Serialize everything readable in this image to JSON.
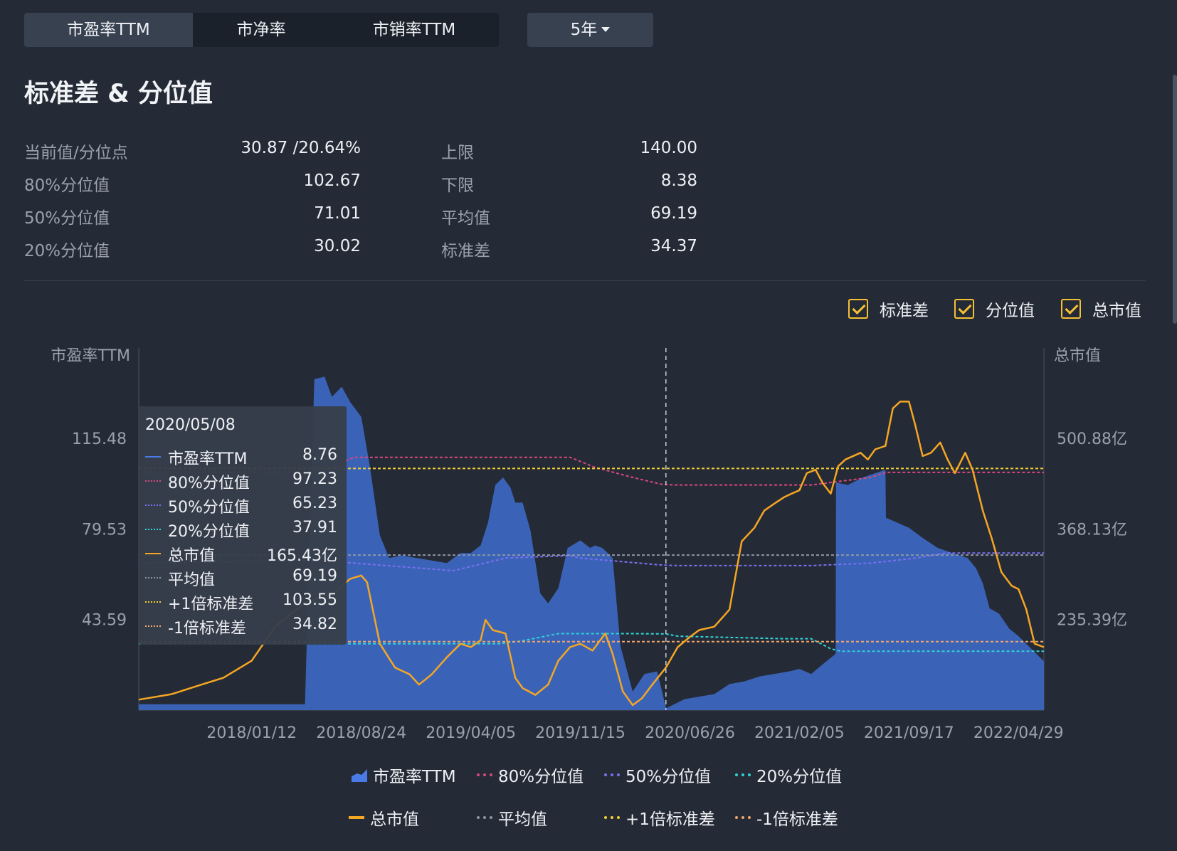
{
  "tabs": [
    {
      "label": "市盈率TTM",
      "active": true
    },
    {
      "label": "市净率",
      "active": false
    },
    {
      "label": "市销率TTM",
      "active": false
    }
  ],
  "period": {
    "label": "5年"
  },
  "heading": "标准差 & 分位值",
  "stats": {
    "left": [
      {
        "label": "当前值/分位点",
        "value": "30.87 /20.64%"
      },
      {
        "label": "80%分位值",
        "value": "102.67"
      },
      {
        "label": "50%分位值",
        "value": "71.01"
      },
      {
        "label": "20%分位值",
        "value": "30.02"
      }
    ],
    "right": [
      {
        "label": "上限",
        "value": "140.00"
      },
      {
        "label": "下限",
        "value": "8.38"
      },
      {
        "label": "平均值",
        "value": "69.19"
      },
      {
        "label": "标准差",
        "value": "34.37"
      }
    ]
  },
  "toggles": [
    {
      "label": "标准差",
      "checked": true
    },
    {
      "label": "分位值",
      "checked": true
    },
    {
      "label": "总市值",
      "checked": true
    }
  ],
  "colors": {
    "pe": "#4a7be8",
    "p80": "#d9477e",
    "p50": "#7b6ff0",
    "p20": "#2fd3d6",
    "mcap": "#f5a623",
    "mean": "#8d96a6",
    "plus1": "#f2cf33",
    "minus1": "#f0a56a"
  },
  "tooltip": {
    "date": "2020/05/08",
    "rows": [
      {
        "key": "pe",
        "name": "市盈率TTM",
        "value": "8.76"
      },
      {
        "key": "p80",
        "name": "80%分位值",
        "value": "97.23"
      },
      {
        "key": "p50",
        "name": "50%分位值",
        "value": "65.23"
      },
      {
        "key": "p20",
        "name": "20%分位值",
        "value": "37.91"
      },
      {
        "key": "mcap",
        "name": "总市值",
        "value": "165.43亿"
      },
      {
        "key": "mean",
        "name": "平均值",
        "value": "69.19"
      },
      {
        "key": "plus1",
        "name": "+1倍标准差",
        "value": "103.55"
      },
      {
        "key": "minus1",
        "name": "-1倍标准差",
        "value": "34.82"
      }
    ]
  },
  "legend": [
    {
      "key": "pe",
      "name": "市盈率TTM",
      "style": "area"
    },
    {
      "key": "p80",
      "name": "80%分位值",
      "style": "dotted"
    },
    {
      "key": "p50",
      "name": "50%分位值",
      "style": "dotted"
    },
    {
      "key": "p20",
      "name": "20%分位值",
      "style": "dotted"
    },
    {
      "key": "mcap",
      "name": "总市值",
      "style": "solid"
    },
    {
      "key": "mean",
      "name": "平均值",
      "style": "dotted"
    },
    {
      "key": "plus1",
      "name": "+1倍标准差",
      "style": "dotted"
    },
    {
      "key": "minus1",
      "name": "-1倍标准差",
      "style": "dotted"
    }
  ],
  "chart_data": {
    "type": "area",
    "xlabel": "",
    "ylabel": "市盈率TTM",
    "y2label": "总市值",
    "ylim": [
      7.65,
      151.4
    ],
    "y2lim": [
      102.65,
      633.6
    ],
    "y_ticks": [
      {
        "value": 43.59,
        "label": "43.59"
      },
      {
        "value": 79.53,
        "label": "79.53"
      },
      {
        "value": 115.48,
        "label": "115.48"
      }
    ],
    "y2_ticks": [
      {
        "value": 235.39,
        "label": "235.39亿"
      },
      {
        "value": 368.13,
        "label": "368.13亿"
      },
      {
        "value": 500.88,
        "label": "500.88亿"
      }
    ],
    "x_ticks": [
      {
        "date": "2018-01-12",
        "label": "2018/01/12"
      },
      {
        "date": "2018-08-24",
        "label": "2018/08/24"
      },
      {
        "date": "2019-04-05",
        "label": "2019/04/05"
      },
      {
        "date": "2019-11-15",
        "label": "2019/11/15"
      },
      {
        "date": "2020-06-26",
        "label": "2020/06/26"
      },
      {
        "date": "2021-02-05",
        "label": "2021/02/05"
      },
      {
        "date": "2021-09-17",
        "label": "2021/09/17"
      },
      {
        "date": "2022-04-29",
        "label": "2022/04/29"
      }
    ],
    "cursor_date": "2020-05-08",
    "series": [
      {
        "name": "市盈率TTM",
        "key": "pe",
        "x": [
          "2017-05-26",
          "2017-07-01",
          "2017-09-01",
          "2017-11-01",
          "2017-12-01",
          "2018-01-12",
          "2018-03-01",
          "2018-04-15",
          "2018-05-01",
          "2018-05-20",
          "2018-06-10",
          "2018-06-25",
          "2018-07-15",
          "2018-08-01",
          "2018-08-24",
          "2018-09-10",
          "2018-10-01",
          "2018-10-20",
          "2018-11-15",
          "2018-12-15",
          "2019-01-15",
          "2019-02-15",
          "2019-03-15",
          "2019-04-05",
          "2019-04-25",
          "2019-05-10",
          "2019-05-25",
          "2019-06-10",
          "2019-06-25",
          "2019-07-05",
          "2019-07-20",
          "2019-08-05",
          "2019-08-25",
          "2019-09-10",
          "2019-10-01",
          "2019-10-20",
          "2019-11-15",
          "2019-12-05",
          "2019-12-15",
          "2019-12-30",
          "2020-01-10",
          "2020-01-20",
          "2020-02-05",
          "2020-03-01",
          "2020-03-25",
          "2020-04-20",
          "2020-05-08",
          "2020-05-09",
          "2020-06-15",
          "2020-07-15",
          "2020-08-15",
          "2020-09-15",
          "2020-10-15",
          "2020-11-15",
          "2020-12-15",
          "2021-01-15",
          "2021-02-05",
          "2021-03-01",
          "2021-04-01",
          "2021-04-20",
          "2021-04-21",
          "2021-05-15",
          "2021-06-15",
          "2021-07-15",
          "2021-07-31",
          "2021-08-01",
          "2021-08-25",
          "2021-09-17",
          "2021-10-15",
          "2021-11-15",
          "2021-12-15",
          "2022-01-15",
          "2022-02-01",
          "2022-02-15",
          "2022-03-01",
          "2022-03-20",
          "2022-04-10",
          "2022-04-29",
          "2022-05-20",
          "2022-06-20"
        ],
        "values": [
          10,
          10,
          10,
          10,
          10,
          10,
          10,
          10,
          10,
          139,
          140,
          132,
          136,
          130,
          124,
          105,
          77,
          68,
          69,
          68,
          67,
          66,
          70,
          70,
          73,
          82,
          97,
          100,
          96,
          90,
          90,
          79,
          54,
          50,
          56,
          72,
          75,
          72,
          73,
          72,
          70,
          68,
          33,
          15,
          22,
          23,
          8.76,
          8.4,
          12,
          13,
          14,
          18,
          19,
          21,
          22,
          23,
          24,
          22,
          27,
          30,
          98,
          97,
          100,
          102,
          103,
          84,
          82,
          80,
          76,
          72,
          70,
          68,
          64,
          58,
          48,
          46,
          40,
          37,
          33,
          27
        ]
      },
      {
        "name": "总市值",
        "key": "mcap",
        "x": [
          "2017-05-26",
          "2017-08-01",
          "2017-10-01",
          "2017-11-15",
          "2018-01-12",
          "2018-03-01",
          "2018-05-01",
          "2018-07-01",
          "2018-08-01",
          "2018-08-24",
          "2018-09-05",
          "2018-10-01",
          "2018-11-01",
          "2018-12-01",
          "2018-12-20",
          "2019-01-15",
          "2019-02-15",
          "2019-03-15",
          "2019-04-05",
          "2019-04-25",
          "2019-05-05",
          "2019-05-20",
          "2019-06-15",
          "2019-07-05",
          "2019-07-20",
          "2019-08-15",
          "2019-09-10",
          "2019-10-01",
          "2019-10-25",
          "2019-11-15",
          "2019-12-10",
          "2020-01-05",
          "2020-01-20",
          "2020-02-10",
          "2020-03-01",
          "2020-03-20",
          "2020-04-10",
          "2020-05-08",
          "2020-06-01",
          "2020-06-26",
          "2020-07-15",
          "2020-08-15",
          "2020-09-15",
          "2020-10-10",
          "2020-11-05",
          "2020-11-25",
          "2020-12-15",
          "2021-01-05",
          "2021-01-20",
          "2021-02-05",
          "2021-02-20",
          "2021-03-10",
          "2021-03-25",
          "2021-04-10",
          "2021-04-25",
          "2021-05-10",
          "2021-06-10",
          "2021-06-25",
          "2021-07-10",
          "2021-07-31",
          "2021-08-15",
          "2021-08-30",
          "2021-09-17",
          "2021-09-30",
          "2021-10-15",
          "2021-11-01",
          "2021-11-20",
          "2021-12-05",
          "2021-12-20",
          "2022-01-10",
          "2022-01-25",
          "2022-02-15",
          "2022-03-05",
          "2022-03-25",
          "2022-04-15",
          "2022-04-29",
          "2022-05-15",
          "2022-06-01",
          "2022-06-20"
        ],
        "values": [
          118,
          126,
          140,
          150,
          175,
          225,
          260,
          275,
          295,
          300,
          290,
          200,
          165,
          155,
          140,
          155,
          180,
          200,
          195,
          205,
          235,
          220,
          215,
          150,
          135,
          125,
          140,
          175,
          195,
          200,
          190,
          215,
          185,
          130,
          110,
          120,
          140,
          165,
          195,
          210,
          220,
          225,
          250,
          350,
          370,
          395,
          405,
          415,
          420,
          425,
          450,
          455,
          435,
          420,
          460,
          470,
          480,
          470,
          485,
          490,
          545,
          555,
          555,
          520,
          475,
          480,
          495,
          470,
          450,
          480,
          455,
          395,
          355,
          305,
          285,
          280,
          250,
          200,
          195
        ]
      },
      {
        "name": "80%分位值",
        "key": "p80",
        "x": [
          "2017-05-26",
          "2018-05-01",
          "2018-06-15",
          "2018-07-15",
          "2018-08-10",
          "2019-01-01",
          "2019-06-01",
          "2019-10-25",
          "2019-12-15",
          "2020-03-01",
          "2020-05-01",
          "2020-06-01",
          "2020-10-01",
          "2021-03-01",
          "2021-07-01",
          "2021-08-01",
          "2022-06-20"
        ],
        "values": [
          102,
          102,
          103,
          106,
          108,
          108,
          108,
          108,
          104,
          100,
          97.2,
          97,
          97,
          97,
          100,
          102,
          102
        ]
      },
      {
        "name": "50%分位值",
        "key": "p50",
        "x": [
          "2017-05-26",
          "2018-06-01",
          "2019-03-01",
          "2019-06-15",
          "2019-10-25",
          "2019-11-15",
          "2020-05-01",
          "2020-06-01",
          "2021-03-01",
          "2021-07-01",
          "2021-10-01",
          "2021-12-01",
          "2022-06-20"
        ],
        "values": [
          66,
          67,
          63,
          68,
          69,
          68,
          65.2,
          65,
          65,
          66,
          68,
          70,
          70
        ]
      },
      {
        "name": "20%分位值",
        "key": "p20",
        "x": [
          "2017-05-26",
          "2019-06-01",
          "2019-07-15",
          "2019-10-01",
          "2020-01-01",
          "2020-03-01",
          "2020-05-08",
          "2020-06-01",
          "2021-01-01",
          "2021-03-01",
          "2021-04-10",
          "2021-05-01",
          "2022-06-20"
        ],
        "values": [
          34,
          34,
          35,
          38,
          38,
          38,
          37.9,
          37,
          36,
          36,
          32,
          31,
          31
        ]
      },
      {
        "name": "平均值",
        "key": "mean",
        "x": [
          "2017-05-26",
          "2022-06-20"
        ],
        "values": [
          69.19,
          69.19
        ]
      },
      {
        "name": "+1倍标准差",
        "key": "plus1",
        "x": [
          "2017-05-26",
          "2022-06-20"
        ],
        "values": [
          103.55,
          103.55
        ]
      },
      {
        "name": "-1倍标准差",
        "key": "minus1",
        "x": [
          "2017-05-26",
          "2022-06-20"
        ],
        "values": [
          34.82,
          34.82
        ]
      }
    ]
  }
}
